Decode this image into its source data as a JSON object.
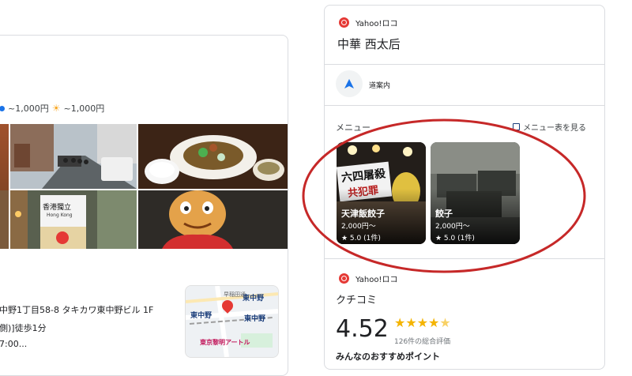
{
  "left": {
    "price_lunch": "~1,000円",
    "price_dinner": "~1,000円",
    "photos": [
      {
        "name": "street-photo",
        "alt": "street"
      },
      {
        "name": "dish-photo",
        "alt": "dish"
      },
      {
        "name": "storefront-photo",
        "alt": "store"
      },
      {
        "name": "mascot-photo",
        "alt": "mascot"
      }
    ],
    "storefront_sign": "香港獨立",
    "storefront_sub": "Hong Kong",
    "address": "中野1丁目58-8 タキカワ東中野ビル 1F",
    "access": "側)]徒歩1分",
    "hours": "7:00...",
    "map": {
      "station1": "東中野",
      "station2": "東中野",
      "station3": "東中野",
      "road": "早稲田通",
      "poi": "東京黎明アートル"
    }
  },
  "right": {
    "source1": "Yahoo!ロコ",
    "title": "中華 西太后",
    "directions_label": "道案内",
    "menu_label": "メニュー",
    "menu_link": "メニュー表を見る",
    "menu_items": [
      {
        "name": "天津飯餃子",
        "price": "2,000円〜",
        "rating": "★ 5.0 (1件)",
        "sign1": "六四屠殺",
        "sign2": "共犯罪"
      },
      {
        "name": "餃子",
        "price": "2,000円〜",
        "rating": "★ 5.0 (1件)"
      }
    ],
    "source2": "Yahoo!ロコ",
    "reviews_label": "クチコミ",
    "rating_value": "4.52",
    "rating_stars": 4.5,
    "rating_count": "126件の総合評価",
    "recommend_label": "みんなのおすすめポイント"
  },
  "colors": {
    "accent": "#1a73e8",
    "pin": "#e53935",
    "star": "#f4b400",
    "circle": "#c62828"
  }
}
